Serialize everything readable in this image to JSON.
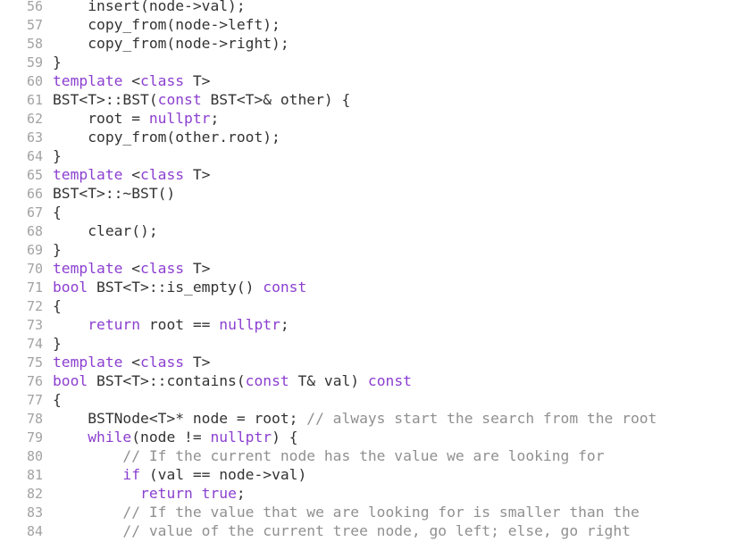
{
  "editor": {
    "name": "code-editor",
    "language": "cpp",
    "background_color": "#ffffff",
    "gutter_color": "#a2a2a2",
    "colors": {
      "keyword": "#8b3fd0",
      "comment": "#909090",
      "plain": "#333333",
      "background": "#ffffff",
      "line_number": "#a2a2a2"
    },
    "first_visible_line": 56,
    "last_visible_line": 84,
    "lines": [
      {
        "number": "56",
        "tokens": [
          {
            "t": "    insert(node->val);",
            "c": "pl"
          }
        ]
      },
      {
        "number": "57",
        "tokens": [
          {
            "t": "    copy_from(node->left);",
            "c": "pl"
          }
        ]
      },
      {
        "number": "58",
        "tokens": [
          {
            "t": "    copy_from(node->right);",
            "c": "pl"
          }
        ]
      },
      {
        "number": "59",
        "tokens": [
          {
            "t": "}",
            "c": "pl"
          }
        ]
      },
      {
        "number": "60",
        "tokens": [
          {
            "t": "template",
            "c": "kw"
          },
          {
            "t": " <",
            "c": "pl"
          },
          {
            "t": "class",
            "c": "kw"
          },
          {
            "t": " T>",
            "c": "pl"
          }
        ]
      },
      {
        "number": "61",
        "tokens": [
          {
            "t": "BST<T>::BST(",
            "c": "pl"
          },
          {
            "t": "const",
            "c": "kw"
          },
          {
            "t": " BST<T>& other) {",
            "c": "pl"
          }
        ]
      },
      {
        "number": "62",
        "tokens": [
          {
            "t": "    root = ",
            "c": "pl"
          },
          {
            "t": "nullptr",
            "c": "kw"
          },
          {
            "t": ";",
            "c": "pl"
          }
        ]
      },
      {
        "number": "63",
        "tokens": [
          {
            "t": "    copy_from(other.root);",
            "c": "pl"
          }
        ]
      },
      {
        "number": "64",
        "tokens": [
          {
            "t": "}",
            "c": "pl"
          }
        ]
      },
      {
        "number": "65",
        "tokens": [
          {
            "t": "template",
            "c": "kw"
          },
          {
            "t": " <",
            "c": "pl"
          },
          {
            "t": "class",
            "c": "kw"
          },
          {
            "t": " T>",
            "c": "pl"
          }
        ]
      },
      {
        "number": "66",
        "tokens": [
          {
            "t": "BST<T>::~BST()",
            "c": "pl"
          }
        ]
      },
      {
        "number": "67",
        "tokens": [
          {
            "t": "{",
            "c": "pl"
          }
        ]
      },
      {
        "number": "68",
        "tokens": [
          {
            "t": "    clear();",
            "c": "pl"
          }
        ]
      },
      {
        "number": "69",
        "tokens": [
          {
            "t": "}",
            "c": "pl"
          }
        ]
      },
      {
        "number": "70",
        "tokens": [
          {
            "t": "template",
            "c": "kw"
          },
          {
            "t": " <",
            "c": "pl"
          },
          {
            "t": "class",
            "c": "kw"
          },
          {
            "t": " T>",
            "c": "pl"
          }
        ]
      },
      {
        "number": "71",
        "tokens": [
          {
            "t": "bool",
            "c": "kw"
          },
          {
            "t": " BST<T>::is_empty() ",
            "c": "pl"
          },
          {
            "t": "const",
            "c": "kw"
          }
        ]
      },
      {
        "number": "72",
        "tokens": [
          {
            "t": "{",
            "c": "pl"
          }
        ]
      },
      {
        "number": "73",
        "tokens": [
          {
            "t": "    ",
            "c": "pl"
          },
          {
            "t": "return",
            "c": "kw"
          },
          {
            "t": " root == ",
            "c": "pl"
          },
          {
            "t": "nullptr",
            "c": "kw"
          },
          {
            "t": ";",
            "c": "pl"
          }
        ]
      },
      {
        "number": "74",
        "tokens": [
          {
            "t": "}",
            "c": "pl"
          }
        ]
      },
      {
        "number": "75",
        "tokens": [
          {
            "t": "template",
            "c": "kw"
          },
          {
            "t": " <",
            "c": "pl"
          },
          {
            "t": "class",
            "c": "kw"
          },
          {
            "t": " T>",
            "c": "pl"
          }
        ]
      },
      {
        "number": "76",
        "tokens": [
          {
            "t": "bool",
            "c": "kw"
          },
          {
            "t": " BST<T>::contains(",
            "c": "pl"
          },
          {
            "t": "const",
            "c": "kw"
          },
          {
            "t": " T& val) ",
            "c": "pl"
          },
          {
            "t": "const",
            "c": "kw"
          }
        ]
      },
      {
        "number": "77",
        "tokens": [
          {
            "t": "{",
            "c": "pl"
          }
        ]
      },
      {
        "number": "78",
        "tokens": [
          {
            "t": "    BSTNode<T>* node = root; ",
            "c": "pl"
          },
          {
            "t": "// always start the search from the root",
            "c": "cm"
          }
        ]
      },
      {
        "number": "79",
        "tokens": [
          {
            "t": "    ",
            "c": "pl"
          },
          {
            "t": "while",
            "c": "kw"
          },
          {
            "t": "(node != ",
            "c": "pl"
          },
          {
            "t": "nullptr",
            "c": "kw"
          },
          {
            "t": ") {",
            "c": "pl"
          }
        ]
      },
      {
        "number": "80",
        "tokens": [
          {
            "t": "        ",
            "c": "pl"
          },
          {
            "t": "// If the current node has the value we are looking for",
            "c": "cm"
          }
        ]
      },
      {
        "number": "81",
        "tokens": [
          {
            "t": "        ",
            "c": "pl"
          },
          {
            "t": "if",
            "c": "kw"
          },
          {
            "t": " (val == node->val)",
            "c": "pl"
          }
        ]
      },
      {
        "number": "82",
        "tokens": [
          {
            "t": "          ",
            "c": "pl"
          },
          {
            "t": "return",
            "c": "kw"
          },
          {
            "t": " ",
            "c": "pl"
          },
          {
            "t": "true",
            "c": "kw"
          },
          {
            "t": ";",
            "c": "pl"
          }
        ]
      },
      {
        "number": "83",
        "tokens": [
          {
            "t": "        ",
            "c": "pl"
          },
          {
            "t": "// If the value that we are looking for is smaller than the",
            "c": "cm"
          }
        ]
      },
      {
        "number": "84",
        "tokens": [
          {
            "t": "        ",
            "c": "pl"
          },
          {
            "t": "// value of the current tree node, go left; else, go right",
            "c": "cm"
          }
        ]
      }
    ]
  }
}
